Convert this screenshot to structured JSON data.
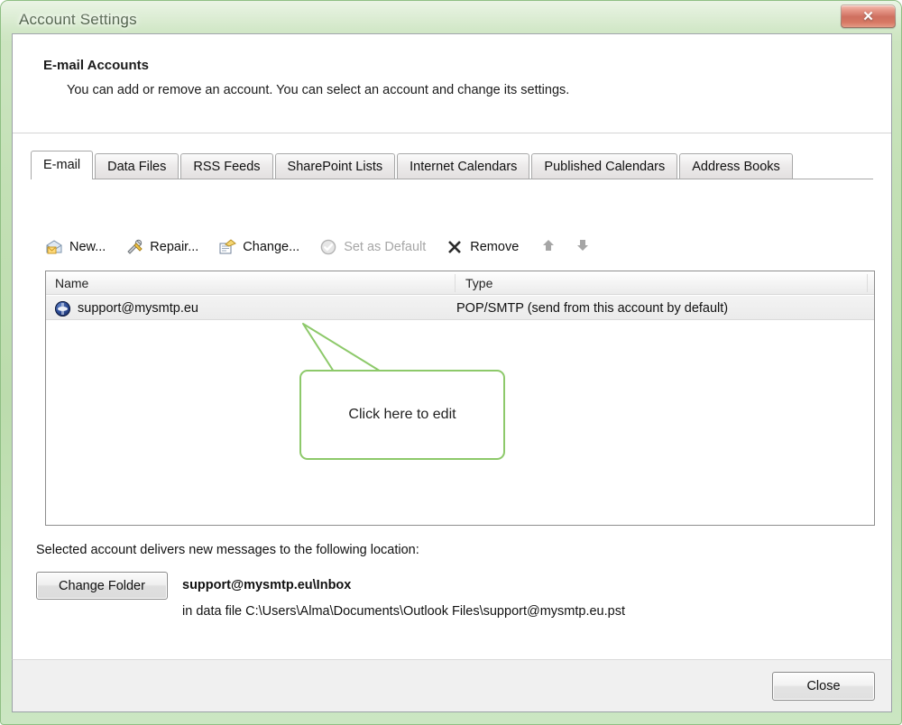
{
  "window": {
    "title": "Account Settings",
    "close_glyph": "✕",
    "accent_green": "#8dc96a",
    "titlebar_green": "#c3e0b5",
    "close_red": "#b9311a"
  },
  "header": {
    "title": "E-mail Accounts",
    "subtitle": "You can add or remove an account. You can select an account and change its settings."
  },
  "tabs": [
    {
      "label": "E-mail",
      "active": true
    },
    {
      "label": "Data Files",
      "active": false
    },
    {
      "label": "RSS Feeds",
      "active": false
    },
    {
      "label": "SharePoint Lists",
      "active": false
    },
    {
      "label": "Internet Calendars",
      "active": false
    },
    {
      "label": "Published Calendars",
      "active": false
    },
    {
      "label": "Address Books",
      "active": false
    }
  ],
  "toolbar": {
    "new_label": "New...",
    "repair_label": "Repair...",
    "change_label": "Change...",
    "set_default_label": "Set as Default",
    "remove_label": "Remove",
    "set_default_enabled": false,
    "move_up_label": "Move Up",
    "move_down_label": "Move Down"
  },
  "list": {
    "columns": [
      "Name",
      "Type"
    ],
    "rows": [
      {
        "name": "support@mysmtp.eu",
        "type": "POP/SMTP (send from this account by default)",
        "selected": true
      }
    ]
  },
  "callout": {
    "text": "Click here to edit"
  },
  "delivery": {
    "label": "Selected account delivers new messages to the following location:",
    "change_folder_label": "Change Folder",
    "location": "support@mysmtp.eu\\Inbox",
    "data_file": "in data file C:\\Users\\Alma\\Documents\\Outlook Files\\support@mysmtp.eu.pst"
  },
  "footer": {
    "close_label": "Close"
  }
}
